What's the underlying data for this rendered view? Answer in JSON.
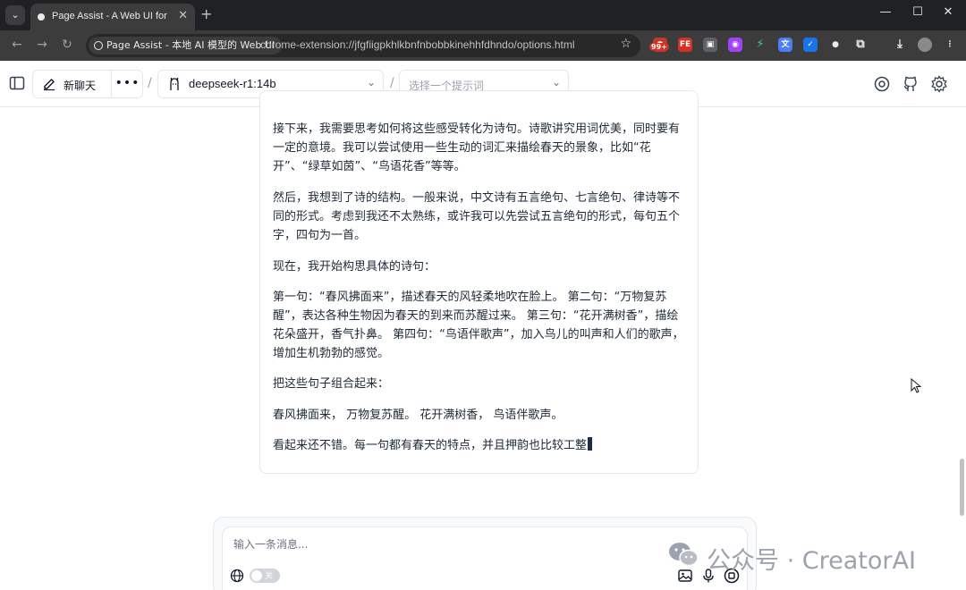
{
  "browser": {
    "tab_title": "Page Assist - A Web UI for Lo",
    "site_chip": "Page Assist - 本地 AI 模型的 Web UI",
    "url": "chrome-extension://jfgfiigpkhlkbnfnbobbkinehhfdhndo/options.html",
    "extension_badge": "99+",
    "extension_fe_label": "FE"
  },
  "header": {
    "new_chat_label": "新聊天",
    "more_label": "•••",
    "separator": "/",
    "model_name": "deepseek-r1:14b",
    "prompt_placeholder": "选择一个提示词"
  },
  "message": {
    "paragraphs": [
      "接下来，我需要思考如何将这些感受转化为诗句。诗歌讲究用词优美，同时要有一定的意境。我可以尝试使用一些生动的词汇来描绘春天的景象，比如“花开”、“绿草如茵”、“鸟语花香”等等。",
      "然后，我想到了诗的结构。一般来说，中文诗有五言绝句、七言绝句、律诗等不同的形式。考虑到我还不太熟练，或许我可以先尝试五言绝句的形式，每句五个字，四句为一首。",
      "现在，我开始构思具体的诗句：",
      "第一句：“春风拂面来”，描述春天的风轻柔地吹在脸上。 第二句：“万物复苏醒”，表达各种生物因为春天的到来而苏醒过来。 第三句：“花开满树香”，描绘花朵盛开，香气扑鼻。 第四句：“鸟语伴歌声”，加入鸟儿的叫声和人们的歌声，增加生机勃勃的感觉。",
      "把这些句子组合起来：",
      "春风拂面来， 万物复苏醒。 花开满树香， 鸟语伴歌声。",
      "看起来还不错。每一句都有春天的特点，并且押韵也比较工整"
    ]
  },
  "composer": {
    "placeholder": "输入一条消息...",
    "toggle_label": "关"
  },
  "watermark": {
    "text": "公众号 · CreatorAI"
  }
}
